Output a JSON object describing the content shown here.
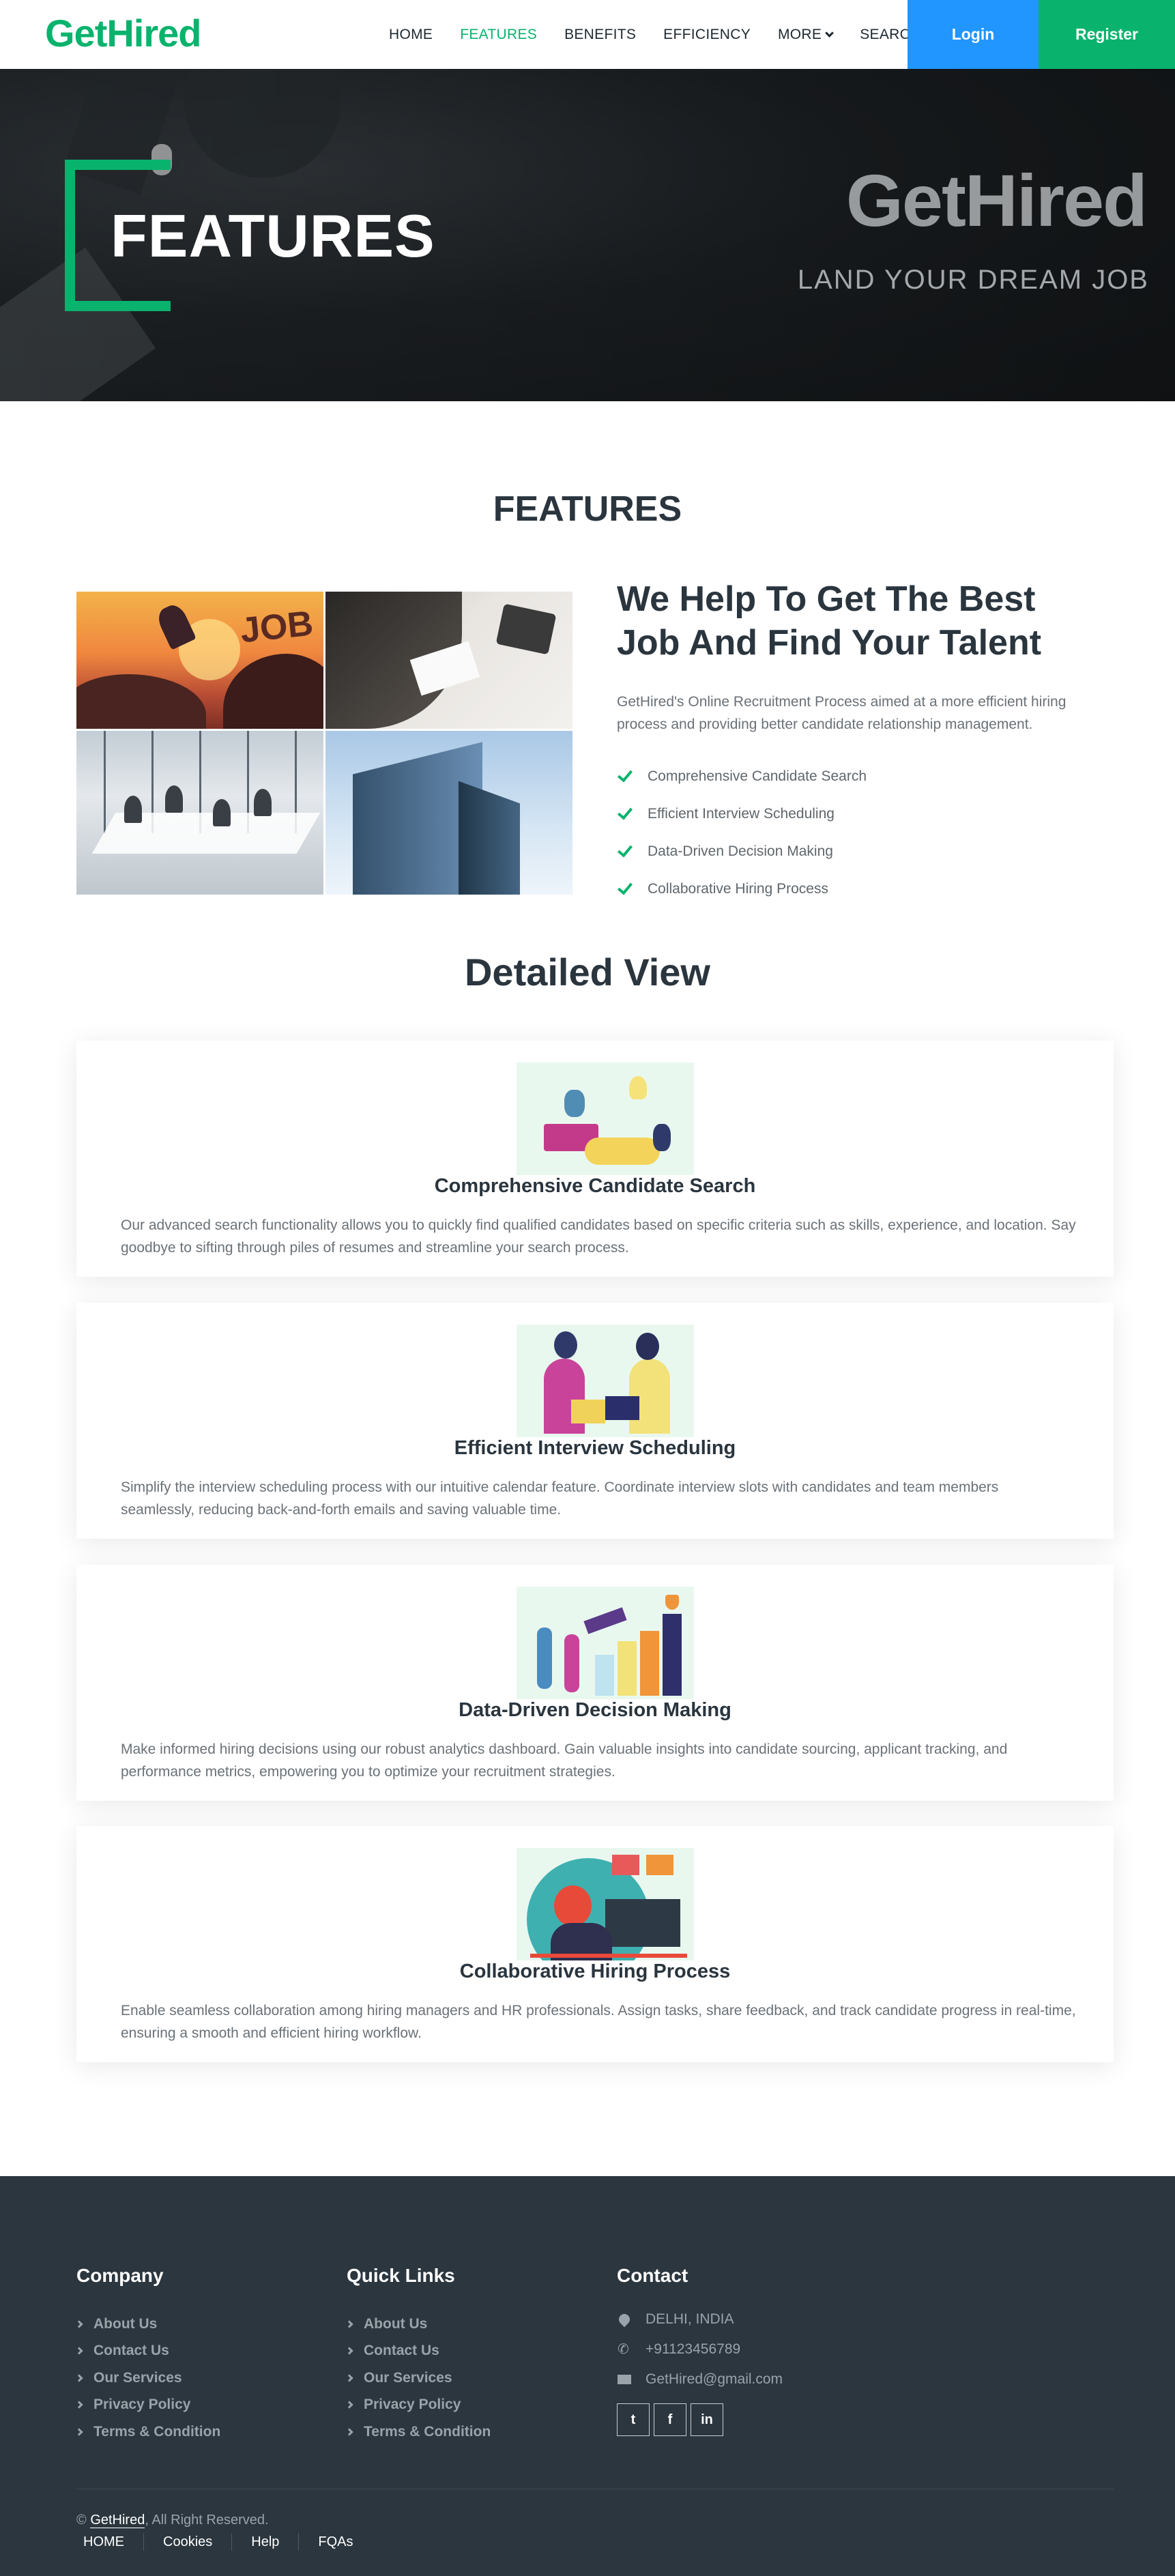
{
  "brand": "GetHired",
  "nav": {
    "links": [
      {
        "label": "HOME"
      },
      {
        "label": "FEATURES",
        "active": true
      },
      {
        "label": "BENEFITS"
      },
      {
        "label": "EFFICIENCY"
      },
      {
        "label": "MORE"
      },
      {
        "label": "SEARCH"
      }
    ],
    "login": "Login",
    "register": "Register"
  },
  "hero": {
    "title": "FEATURES",
    "brand": "GetHired",
    "tagline": "LAND YOUR DREAM JOB"
  },
  "features_section": {
    "title": "FEATURES",
    "heading": "We Help To Get The Best Job And Find Your Talent",
    "description": "GetHired's Online Recruitment Process aimed at a more efficient hiring process and providing better candidate relationship management.",
    "photo_text": "JOB",
    "checklist": [
      "Comprehensive Candidate Search",
      "Efficient Interview Scheduling",
      "Data-Driven Decision Making",
      "Collaborative Hiring Process"
    ]
  },
  "detailed": {
    "title": "Detailed View",
    "cards": [
      {
        "title": "Comprehensive Candidate Search",
        "text": "Our advanced search functionality allows you to quickly find qualified candidates based on specific criteria such as skills, experience, and location. Say goodbye to sifting through piles of resumes and streamline your search process."
      },
      {
        "title": "Efficient Interview Scheduling",
        "text": "Simplify the interview scheduling process with our intuitive calendar feature. Coordinate interview slots with candidates and team members seamlessly, reducing back-and-forth emails and saving valuable time."
      },
      {
        "title": "Data-Driven Decision Making",
        "text": "Make informed hiring decisions using our robust analytics dashboard. Gain valuable insights into candidate sourcing, applicant tracking, and performance metrics, empowering you to optimize your recruitment strategies."
      },
      {
        "title": "Collaborative Hiring Process",
        "text": "Enable seamless collaboration among hiring managers and HR professionals. Assign tasks, share feedback, and track candidate progress in real-time, ensuring a smooth and efficient hiring workflow."
      }
    ]
  },
  "footer": {
    "company": {
      "title": "Company",
      "items": [
        "About Us",
        "Contact Us",
        "Our Services",
        "Privacy Policy",
        "Terms & Condition"
      ]
    },
    "quick_links": {
      "title": "Quick Links",
      "items": [
        "About Us",
        "Contact Us",
        "Our Services",
        "Privacy Policy",
        "Terms & Condition"
      ]
    },
    "contact": {
      "title": "Contact",
      "location": "DELHI, INDIA",
      "phone": "+91123456789",
      "email": "GetHired@gmail.com"
    },
    "socials": [
      {
        "icon": "twitter-icon",
        "glyph": "t"
      },
      {
        "icon": "facebook-icon",
        "glyph": "f"
      },
      {
        "icon": "linkedin-icon",
        "glyph": "in"
      }
    ],
    "copyright_prefix": "©",
    "copyright_brand": "GetHired",
    "copyright_suffix": ", All Right Reserved.",
    "bottom_links": [
      "HOME",
      "Cookies",
      "Help",
      "FQAs"
    ]
  },
  "colors": {
    "accent": "#09b36d",
    "login_blue": "#2196ff",
    "dark": "#2b363e"
  }
}
